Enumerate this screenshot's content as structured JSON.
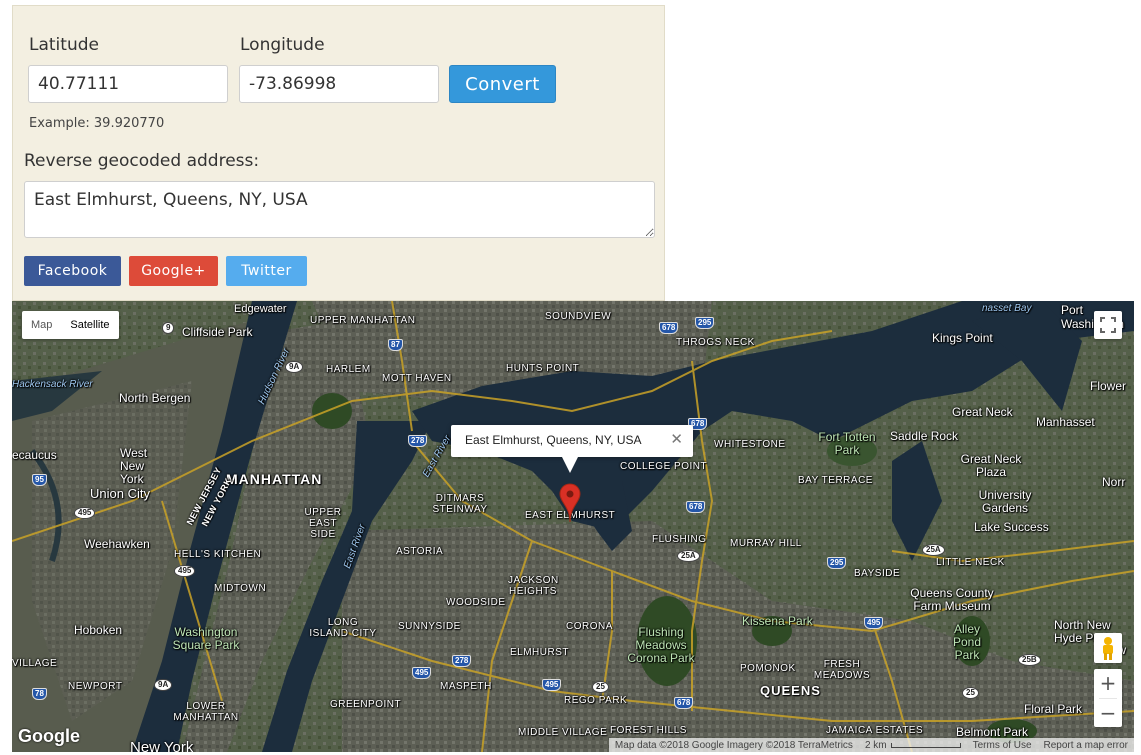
{
  "form": {
    "latitude_label": "Latitude",
    "longitude_label": "Longitude",
    "latitude_value": "40.77111",
    "longitude_value": "-73.86998",
    "convert_label": "Convert",
    "example_text": "Example: 39.920770",
    "address_label": "Reverse geocoded address:",
    "address_value": "East Elmhurst, Queens, NY, USA"
  },
  "share": {
    "facebook": "Facebook",
    "googleplus": "Google+",
    "twitter": "Twitter"
  },
  "map": {
    "type_map": "Map",
    "type_satellite": "Satellite",
    "selected_type": "Satellite",
    "infowindow_text": "East Elmhurst, Queens, NY, USA",
    "infowindow_close": "✕",
    "zoom_in": "+",
    "zoom_out": "−",
    "logo": "Google",
    "attribution": "Map data ©2018 Google Imagery ©2018 TerraMetrics",
    "scale": "2 km",
    "terms": "Terms of Use",
    "report": "Report a map error",
    "colors": {
      "marker": "#d93025",
      "water": "#1c2d3d",
      "land": "#4b5540",
      "park": "#2f4a25"
    },
    "labels": {
      "edgewater": "Edgewater",
      "upper_manhattan": "UPPER MANHATTAN",
      "soundview": "SOUNDVIEW",
      "port_washington": "Port Washington",
      "cliffside_park": "Cliffside Park",
      "throgs_neck": "THROGS NECK",
      "kings_point": "Kings Point",
      "harlem": "HARLEM",
      "mott_haven": "MOTT HAVEN",
      "hunts_point": "HUNTS POINT",
      "hackensack_river": "Hackensack River",
      "flower": "Flower",
      "north_bergen": "North Bergen",
      "great_neck": "Great Neck",
      "manhasset": "Manhasset",
      "whitestone": "WHITESTONE",
      "fort_totten_park": "Fort Totten Park",
      "saddle_rock": "Saddle Rock",
      "secaucus": "ecaucus",
      "west_new_york": "West New York",
      "manhattan": "MANHATTAN",
      "college_point": "COLLEGE POINT",
      "great_neck_plaza": "Great Neck Plaza",
      "union_city": "Union City",
      "new_jersey": "NEW JERSEY",
      "new_york": "NEW YORK",
      "ditmars_steinway": "DITMARS STEINWAY",
      "bay_terrace": "BAY TERRACE",
      "university_gardens": "University Gardens",
      "upper_east_side": "UPPER EAST SIDE",
      "east_elmhurst": "EAST ELMHURST",
      "lake_success": "Lake Success",
      "weehawken": "Weehawken",
      "flushing": "FLUSHING",
      "murray_hill": "MURRAY HILL",
      "hells_kitchen": "HELL'S KITCHEN",
      "astoria": "ASTORIA",
      "little_neck": "LITTLE NECK",
      "midtown": "MIDTOWN",
      "jackson_heights": "JACKSON HEIGHTS",
      "bayside": "BAYSIDE",
      "queens_county_farm": "Queens County Farm Museum",
      "woodside": "WOODSIDE",
      "north_new_hyde_park": "North New Hyde Park",
      "hoboken": "Hoboken",
      "washington_square_park": "Washington Square Park",
      "long_island_city": "LONG ISLAND CITY",
      "sunnyside": "SUNNYSIDE",
      "corona": "CORONA",
      "kissena_park": "Kissena Park",
      "alley_pond_park": "Alley Pond Park",
      "flushing_meadows": "Flushing Meadows Corona Park",
      "elmhurst": "ELMHURST",
      "pomonok": "POMONOK",
      "fresh_meadows": "FRESH MEADOWS",
      "village": "VILLAGE",
      "newport": "NEWPORT",
      "maspeth": "MASPETH",
      "queens": "QUEENS",
      "lower_manhattan": "LOWER MANHATTAN",
      "greenpoint": "GREENPOINT",
      "rego_park": "REGO PARK",
      "forest_hills": "FOREST HILLS",
      "floral_park": "Floral Park",
      "middle_village": "MIDDLE VILLAGE",
      "jamaica_estates": "JAMAICA ESTATES",
      "belmont_park": "Belmont Park",
      "new_york_city": "New York",
      "hudson_river": "Hudson River",
      "east_river": "East River",
      "new_hyde": "New",
      "norr": "Norr",
      "nassett_bay": "nasset Bay"
    },
    "shields": {
      "r9": "9",
      "r87": "87",
      "r678a": "678",
      "r295a": "295",
      "r9a": "9A",
      "r278a": "278",
      "r678b": "678",
      "r95": "95",
      "r495a": "495",
      "r678c": "678",
      "r25a": "25A",
      "r295b": "295",
      "r25a2": "25A",
      "r495b": "495",
      "r278b": "278",
      "r495c": "495",
      "r495d": "495",
      "r25": "25",
      "r25b": "25B",
      "r25c": "25",
      "r78": "78",
      "r9a2": "9A",
      "r678d": "678",
      "r495e": "495"
    }
  }
}
